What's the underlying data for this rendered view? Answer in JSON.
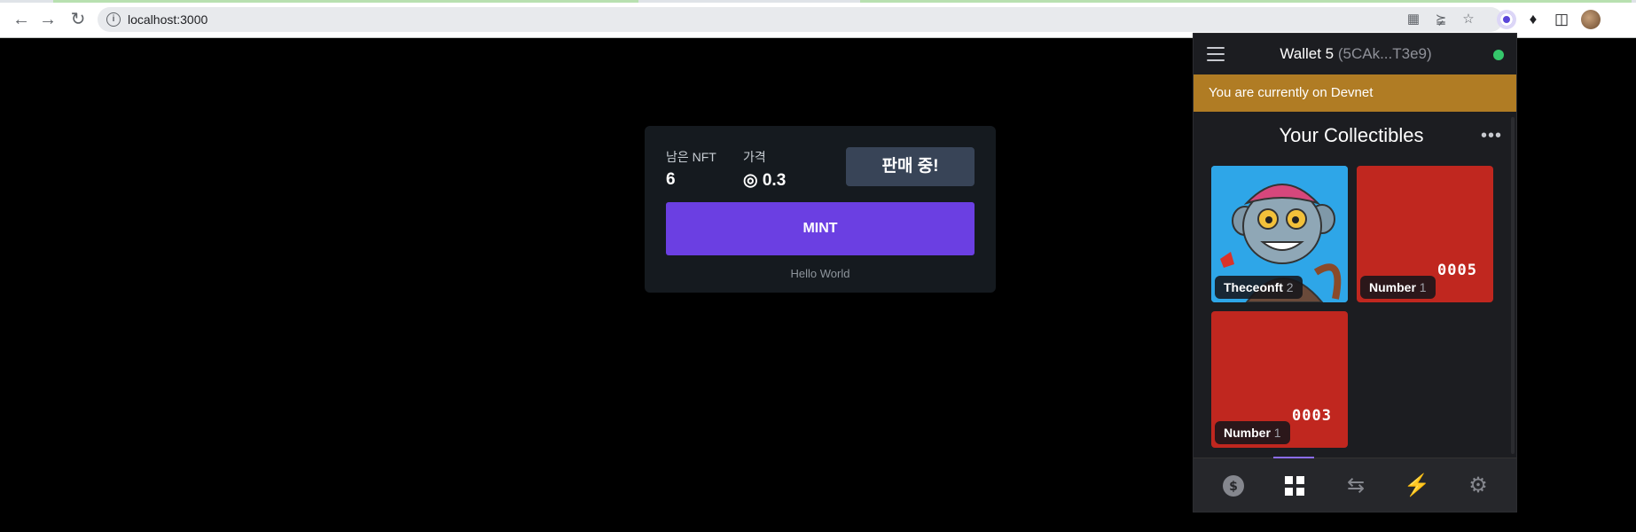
{
  "browser": {
    "url": "localhost:3000",
    "icons": [
      "back-icon",
      "forward-icon",
      "reload-icon",
      "info-icon",
      "translate-icon",
      "share-icon",
      "bookmark-star-icon",
      "wallet-extension-icon",
      "puzzle-extensions-icon",
      "sidepanel-icon",
      "profile-avatar"
    ]
  },
  "mint_card": {
    "remaining_label": "남은 NFT",
    "remaining_value": "6",
    "price_label": "가격",
    "price_value": "◎ 0.3",
    "sale_button": "판매 중!",
    "mint_button": "MINT",
    "footer": "Hello World"
  },
  "wallet": {
    "name": "Wallet 5",
    "address": "(5CAk...T3e9)",
    "network_banner": "You are currently on Devnet",
    "section_title": "Your Collectibles",
    "collectibles": [
      {
        "name": "Theceonft",
        "count": "2",
        "art": "monkey-avatar-image"
      },
      {
        "name": "Number",
        "count": "1",
        "art_text": "0005"
      },
      {
        "name": "Number",
        "count": "1",
        "art_text": "0003"
      }
    ],
    "nav": [
      "balance-icon",
      "collectibles-grid-icon",
      "swap-arrows-icon",
      "activity-bolt-icon",
      "settings-gear-icon"
    ],
    "active_nav": "collectibles-grid-icon",
    "colors": {
      "banner": "#b07c24",
      "accent": "#8b6cf0",
      "status": "#35c76b",
      "mint": "#6b3fe2"
    }
  }
}
